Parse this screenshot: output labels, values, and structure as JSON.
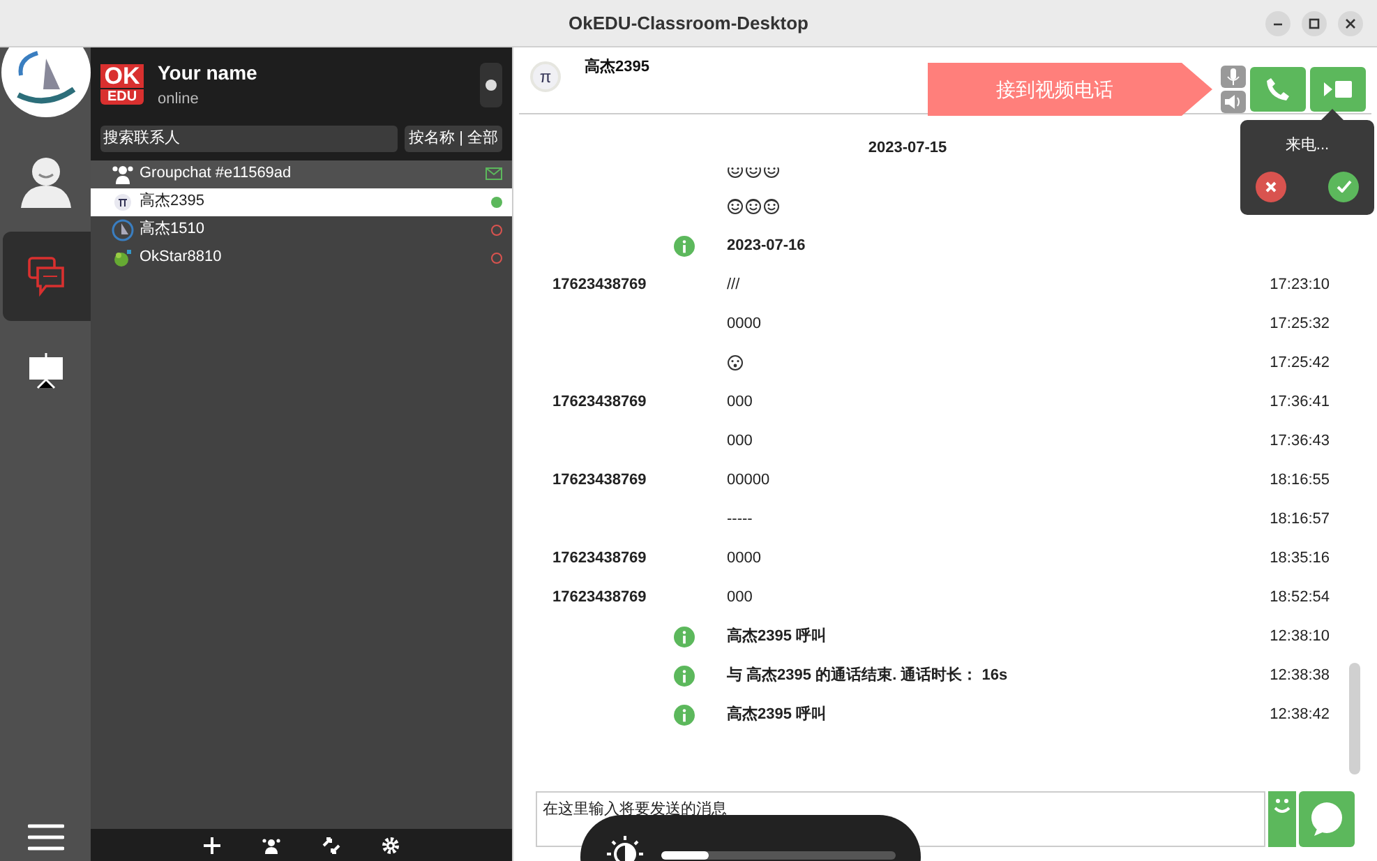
{
  "window": {
    "title": "OkEDU-Classroom-Desktop"
  },
  "rail": {
    "items": [
      {
        "kind": "contacts",
        "selected": false
      },
      {
        "kind": "chat",
        "selected": true
      },
      {
        "kind": "board",
        "selected": false
      }
    ]
  },
  "profile": {
    "logo_top": "OK",
    "logo_bottom": "EDU",
    "name": "Your name",
    "status": "online"
  },
  "search": {
    "placeholder": "搜索联系人",
    "filter": "按名称 | 全部"
  },
  "contacts": [
    {
      "kind": "group",
      "name": "Groupchat #e11569ad",
      "unread": true,
      "selected": false
    },
    {
      "kind": "pi",
      "name": "高杰2395",
      "online": true,
      "selected": true
    },
    {
      "kind": "sail",
      "name": "高杰1510",
      "online": false,
      "selected": false
    },
    {
      "kind": "frog",
      "name": "OkStar8810",
      "online": false,
      "selected": false
    }
  ],
  "chat": {
    "contact": "高杰2395",
    "avatar": "π",
    "call_banner": "接到视频电话",
    "popup": {
      "title": "来电..."
    },
    "messages": [
      {
        "kind": "date",
        "text": "2023-07-15"
      },
      {
        "kind": "emoji",
        "emojis": [
          {
            "kind": "grin"
          },
          {
            "kind": "grin"
          },
          {
            "kind": "grin"
          }
        ],
        "partial": true
      },
      {
        "kind": "emoji",
        "emojis": [
          {
            "kind": "halo"
          },
          {
            "kind": "halo"
          },
          {
            "kind": "halo"
          }
        ],
        "partial": false
      },
      {
        "kind": "notice",
        "text": "2023-07-16"
      },
      {
        "kind": "message",
        "sender": "17623438769",
        "text": "///",
        "time": "17:23:10"
      },
      {
        "kind": "message",
        "text": "0000",
        "time": "17:25:32"
      },
      {
        "kind": "emoji_message",
        "emojis": [
          {
            "kind": "surprised"
          }
        ],
        "time": "17:25:42"
      },
      {
        "kind": "message",
        "sender": "17623438769",
        "text": "000",
        "time": "17:36:41"
      },
      {
        "kind": "message",
        "text": "000",
        "time": "17:36:43"
      },
      {
        "kind": "message",
        "sender": "17623438769",
        "text": "00000",
        "time": "18:16:55"
      },
      {
        "kind": "message",
        "text": "-----",
        "time": "18:16:57"
      },
      {
        "kind": "message",
        "sender": "17623438769",
        "text": "0000",
        "time": "18:35:16"
      },
      {
        "kind": "message",
        "sender": "17623438769",
        "text": "000",
        "time": "18:52:54"
      },
      {
        "kind": "notice",
        "text": "高杰2395 呼叫",
        "time": "12:38:10"
      },
      {
        "kind": "notice",
        "text": "与 高杰2395 的通话结束. 通话时长： 16s",
        "time": "12:38:38"
      },
      {
        "kind": "notice",
        "text": "高杰2395 呼叫",
        "time": "12:38:42"
      }
    ],
    "input": {
      "placeholder": "在这里输入将要发送的消息"
    }
  },
  "osd": {
    "level": 0.2
  }
}
